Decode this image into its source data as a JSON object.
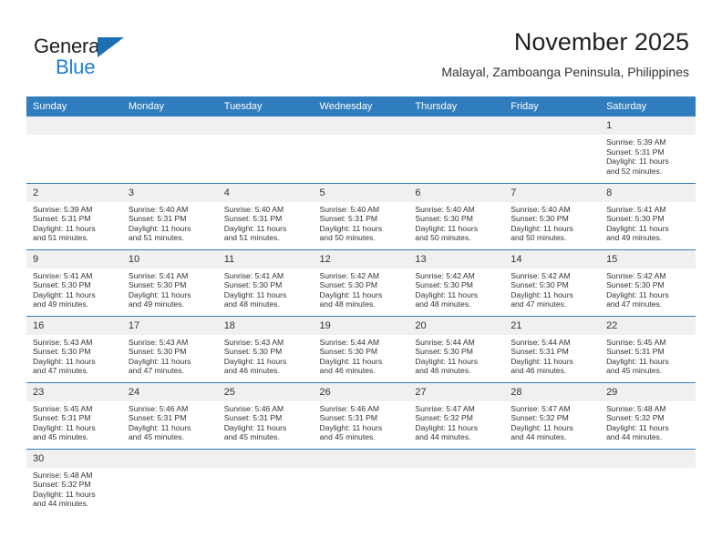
{
  "logo": {
    "word_top": "General",
    "word_bottom": "Blue",
    "triangle_color": "#1b6fb5",
    "blue_color": "#1b7fd4"
  },
  "header": {
    "title": "November 2025",
    "subtitle": "Malayal, Zamboanga Peninsula, Philippines"
  },
  "colors": {
    "header_band": "#2f7cbe",
    "daynum_band": "#f0f0f0",
    "text": "#333333"
  },
  "weekdays": [
    "Sunday",
    "Monday",
    "Tuesday",
    "Wednesday",
    "Thursday",
    "Friday",
    "Saturday"
  ],
  "labels": {
    "sunrise_prefix": "Sunrise:",
    "sunset_prefix": "Sunset:",
    "daylight_prefix": "Daylight:"
  },
  "weeks": [
    [
      {
        "day": "",
        "empty": true
      },
      {
        "day": "",
        "empty": true
      },
      {
        "day": "",
        "empty": true
      },
      {
        "day": "",
        "empty": true
      },
      {
        "day": "",
        "empty": true
      },
      {
        "day": "",
        "empty": true
      },
      {
        "day": "1",
        "sunrise": "Sunrise: 5:39 AM",
        "sunset": "Sunset: 5:31 PM",
        "daylight1": "Daylight: 11 hours",
        "daylight2": "and 52 minutes."
      }
    ],
    [
      {
        "day": "2",
        "sunrise": "Sunrise: 5:39 AM",
        "sunset": "Sunset: 5:31 PM",
        "daylight1": "Daylight: 11 hours",
        "daylight2": "and 51 minutes."
      },
      {
        "day": "3",
        "sunrise": "Sunrise: 5:40 AM",
        "sunset": "Sunset: 5:31 PM",
        "daylight1": "Daylight: 11 hours",
        "daylight2": "and 51 minutes."
      },
      {
        "day": "4",
        "sunrise": "Sunrise: 5:40 AM",
        "sunset": "Sunset: 5:31 PM",
        "daylight1": "Daylight: 11 hours",
        "daylight2": "and 51 minutes."
      },
      {
        "day": "5",
        "sunrise": "Sunrise: 5:40 AM",
        "sunset": "Sunset: 5:31 PM",
        "daylight1": "Daylight: 11 hours",
        "daylight2": "and 50 minutes."
      },
      {
        "day": "6",
        "sunrise": "Sunrise: 5:40 AM",
        "sunset": "Sunset: 5:30 PM",
        "daylight1": "Daylight: 11 hours",
        "daylight2": "and 50 minutes."
      },
      {
        "day": "7",
        "sunrise": "Sunrise: 5:40 AM",
        "sunset": "Sunset: 5:30 PM",
        "daylight1": "Daylight: 11 hours",
        "daylight2": "and 50 minutes."
      },
      {
        "day": "8",
        "sunrise": "Sunrise: 5:41 AM",
        "sunset": "Sunset: 5:30 PM",
        "daylight1": "Daylight: 11 hours",
        "daylight2": "and 49 minutes."
      }
    ],
    [
      {
        "day": "9",
        "sunrise": "Sunrise: 5:41 AM",
        "sunset": "Sunset: 5:30 PM",
        "daylight1": "Daylight: 11 hours",
        "daylight2": "and 49 minutes."
      },
      {
        "day": "10",
        "sunrise": "Sunrise: 5:41 AM",
        "sunset": "Sunset: 5:30 PM",
        "daylight1": "Daylight: 11 hours",
        "daylight2": "and 49 minutes."
      },
      {
        "day": "11",
        "sunrise": "Sunrise: 5:41 AM",
        "sunset": "Sunset: 5:30 PM",
        "daylight1": "Daylight: 11 hours",
        "daylight2": "and 48 minutes."
      },
      {
        "day": "12",
        "sunrise": "Sunrise: 5:42 AM",
        "sunset": "Sunset: 5:30 PM",
        "daylight1": "Daylight: 11 hours",
        "daylight2": "and 48 minutes."
      },
      {
        "day": "13",
        "sunrise": "Sunrise: 5:42 AM",
        "sunset": "Sunset: 5:30 PM",
        "daylight1": "Daylight: 11 hours",
        "daylight2": "and 48 minutes."
      },
      {
        "day": "14",
        "sunrise": "Sunrise: 5:42 AM",
        "sunset": "Sunset: 5:30 PM",
        "daylight1": "Daylight: 11 hours",
        "daylight2": "and 47 minutes."
      },
      {
        "day": "15",
        "sunrise": "Sunrise: 5:42 AM",
        "sunset": "Sunset: 5:30 PM",
        "daylight1": "Daylight: 11 hours",
        "daylight2": "and 47 minutes."
      }
    ],
    [
      {
        "day": "16",
        "sunrise": "Sunrise: 5:43 AM",
        "sunset": "Sunset: 5:30 PM",
        "daylight1": "Daylight: 11 hours",
        "daylight2": "and 47 minutes."
      },
      {
        "day": "17",
        "sunrise": "Sunrise: 5:43 AM",
        "sunset": "Sunset: 5:30 PM",
        "daylight1": "Daylight: 11 hours",
        "daylight2": "and 47 minutes."
      },
      {
        "day": "18",
        "sunrise": "Sunrise: 5:43 AM",
        "sunset": "Sunset: 5:30 PM",
        "daylight1": "Daylight: 11 hours",
        "daylight2": "and 46 minutes."
      },
      {
        "day": "19",
        "sunrise": "Sunrise: 5:44 AM",
        "sunset": "Sunset: 5:30 PM",
        "daylight1": "Daylight: 11 hours",
        "daylight2": "and 46 minutes."
      },
      {
        "day": "20",
        "sunrise": "Sunrise: 5:44 AM",
        "sunset": "Sunset: 5:30 PM",
        "daylight1": "Daylight: 11 hours",
        "daylight2": "and 46 minutes."
      },
      {
        "day": "21",
        "sunrise": "Sunrise: 5:44 AM",
        "sunset": "Sunset: 5:31 PM",
        "daylight1": "Daylight: 11 hours",
        "daylight2": "and 46 minutes."
      },
      {
        "day": "22",
        "sunrise": "Sunrise: 5:45 AM",
        "sunset": "Sunset: 5:31 PM",
        "daylight1": "Daylight: 11 hours",
        "daylight2": "and 45 minutes."
      }
    ],
    [
      {
        "day": "23",
        "sunrise": "Sunrise: 5:45 AM",
        "sunset": "Sunset: 5:31 PM",
        "daylight1": "Daylight: 11 hours",
        "daylight2": "and 45 minutes."
      },
      {
        "day": "24",
        "sunrise": "Sunrise: 5:46 AM",
        "sunset": "Sunset: 5:31 PM",
        "daylight1": "Daylight: 11 hours",
        "daylight2": "and 45 minutes."
      },
      {
        "day": "25",
        "sunrise": "Sunrise: 5:46 AM",
        "sunset": "Sunset: 5:31 PM",
        "daylight1": "Daylight: 11 hours",
        "daylight2": "and 45 minutes."
      },
      {
        "day": "26",
        "sunrise": "Sunrise: 5:46 AM",
        "sunset": "Sunset: 5:31 PM",
        "daylight1": "Daylight: 11 hours",
        "daylight2": "and 45 minutes."
      },
      {
        "day": "27",
        "sunrise": "Sunrise: 5:47 AM",
        "sunset": "Sunset: 5:32 PM",
        "daylight1": "Daylight: 11 hours",
        "daylight2": "and 44 minutes."
      },
      {
        "day": "28",
        "sunrise": "Sunrise: 5:47 AM",
        "sunset": "Sunset: 5:32 PM",
        "daylight1": "Daylight: 11 hours",
        "daylight2": "and 44 minutes."
      },
      {
        "day": "29",
        "sunrise": "Sunrise: 5:48 AM",
        "sunset": "Sunset: 5:32 PM",
        "daylight1": "Daylight: 11 hours",
        "daylight2": "and 44 minutes."
      }
    ],
    [
      {
        "day": "30",
        "sunrise": "Sunrise: 5:48 AM",
        "sunset": "Sunset: 5:32 PM",
        "daylight1": "Daylight: 11 hours",
        "daylight2": "and 44 minutes."
      },
      {
        "day": "",
        "empty": true
      },
      {
        "day": "",
        "empty": true
      },
      {
        "day": "",
        "empty": true
      },
      {
        "day": "",
        "empty": true
      },
      {
        "day": "",
        "empty": true
      },
      {
        "day": "",
        "empty": true
      }
    ]
  ]
}
